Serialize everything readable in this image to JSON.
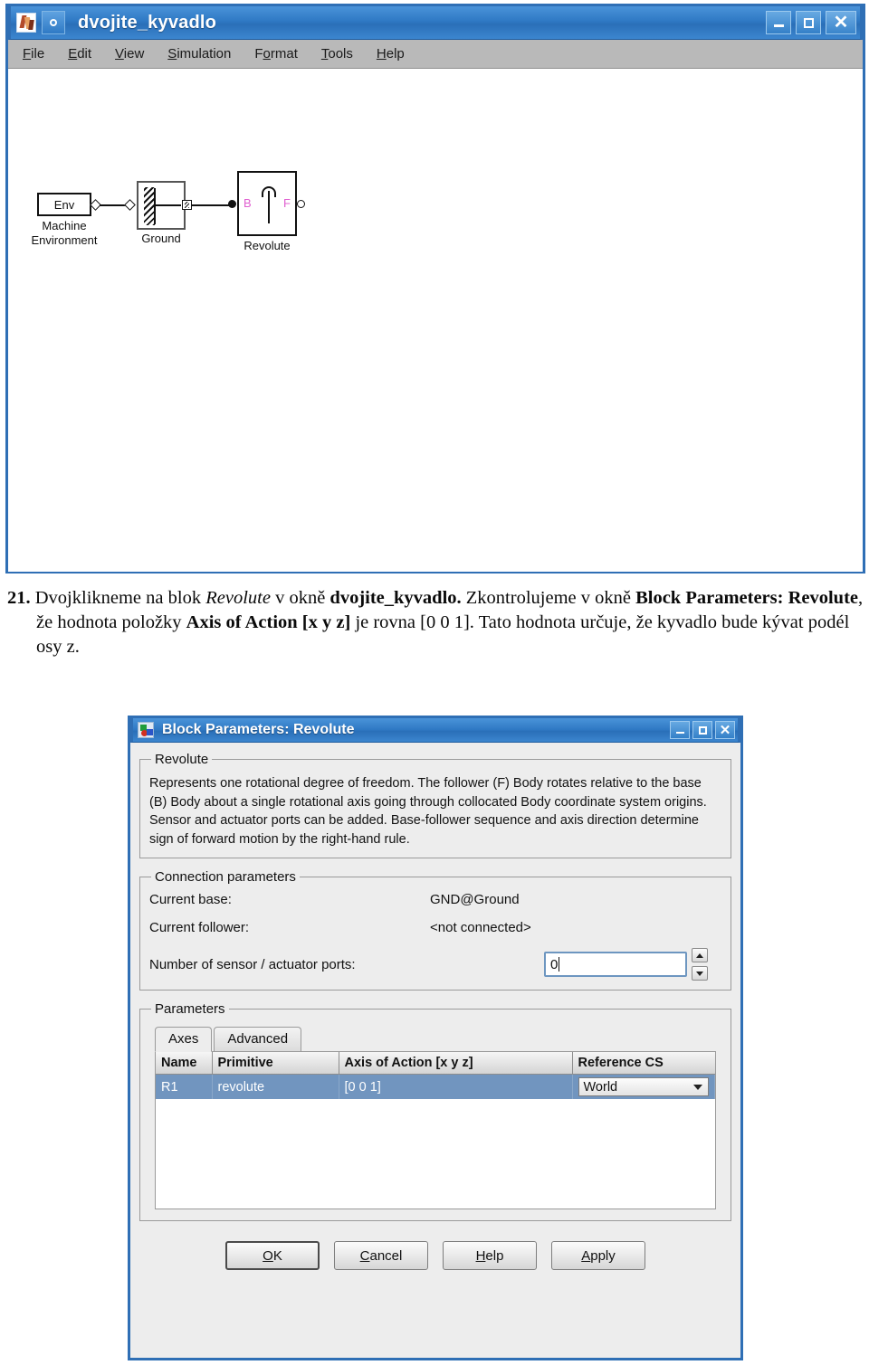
{
  "sim_window": {
    "title": "dvojite_kyvadlo",
    "app_icon": "matlab-icon",
    "sim_button_icon": "simulink-circle-icon",
    "window_buttons": {
      "minimize": "–",
      "maximize": "□",
      "close": "✕"
    },
    "menus": [
      {
        "label": "File",
        "mnemonic": "F"
      },
      {
        "label": "Edit",
        "mnemonic": "E"
      },
      {
        "label": "View",
        "mnemonic": "V"
      },
      {
        "label": "Simulation",
        "mnemonic": "S"
      },
      {
        "label": "Format",
        "mnemonic": "o"
      },
      {
        "label": "Tools",
        "mnemonic": "T"
      },
      {
        "label": "Help",
        "mnemonic": "H"
      }
    ],
    "blocks": [
      {
        "inner_label": "Env",
        "label_line1": "Machine",
        "label_line2": "Environment"
      },
      {
        "label": "Ground"
      },
      {
        "label": "Revolute",
        "port_b": "B",
        "port_f": "F"
      }
    ]
  },
  "caption": {
    "number": "21.",
    "seg1": "Dvojklikneme na blok ",
    "seg2_italic": "Revolute",
    "seg3": " v okně ",
    "seg4_bold": "dvojite_kyvadlo.",
    "seg5": " Zkontrolujeme v okně ",
    "seg6_bold": "Block Parameters: Revolute",
    "seg7": ", že hodnota položky ",
    "seg8_bold": "Axis of Action [x y z]",
    "seg9": " je rovna [0 0 1]. Tato hodnota určuje, že kyvadlo bude kývat podél osy z."
  },
  "dialog": {
    "title": "Block Parameters: Revolute",
    "icon": "simmechanics-block-icon",
    "window_buttons": {
      "minimize": "–",
      "maximize": "□",
      "close": "✕"
    },
    "description_group": {
      "legend": "Revolute",
      "text": "Represents one rotational degree of freedom. The follower (F) Body rotates relative to the base (B) Body about a single rotational axis going through collocated Body coordinate system origins. Sensor and actuator ports can be added. Base-follower sequence and axis direction determine sign of forward motion by the right-hand rule."
    },
    "connection_group": {
      "legend": "Connection parameters",
      "current_base_label": "Current base:",
      "current_base_value": "GND@Ground",
      "current_follower_label": "Current follower:",
      "current_follower_value": "<not connected>",
      "ports_label": "Number of sensor / actuator ports:",
      "ports_value": "0",
      "spin_up_icon": "triangle-up-icon",
      "spin_down_icon": "triangle-down-icon"
    },
    "parameters_group": {
      "legend": "Parameters",
      "tabs": [
        {
          "label": "Axes",
          "active": true
        },
        {
          "label": "Advanced",
          "active": false
        }
      ],
      "table": {
        "columns": [
          "Name",
          "Primitive",
          "Axis of Action [x y z]",
          "Reference CS"
        ],
        "rows": [
          {
            "name": "R1",
            "primitive": "revolute",
            "axis": "[0 0 1]",
            "reference_cs": "World",
            "selected": true
          }
        ]
      }
    },
    "buttons": [
      {
        "label": "OK",
        "mnemonic": "O",
        "default": true
      },
      {
        "label": "Cancel",
        "mnemonic": "C",
        "default": false
      },
      {
        "label": "Help",
        "mnemonic": "H",
        "default": false
      },
      {
        "label": "Apply",
        "mnemonic": "A",
        "default": false
      }
    ]
  },
  "colors": {
    "titlebar_blue": "#2f79c4",
    "window_border": "#2f6fb5",
    "dialog_bg": "#ededed",
    "menubar_gray": "#b9b9b9",
    "selected_row_blue": "#7195bf",
    "port_label_pink": "#e060d0"
  }
}
